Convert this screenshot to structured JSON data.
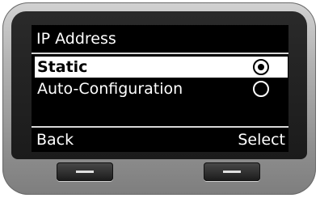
{
  "screen": {
    "title": "IP Address",
    "options": [
      {
        "label": "Static",
        "selected": true,
        "checked": true
      },
      {
        "label": "Auto-Configuration",
        "selected": false,
        "checked": false
      }
    ]
  },
  "softkeys": {
    "left_label": "Back",
    "right_label": "Select"
  },
  "colors": {
    "screen_bg": "#000000",
    "screen_text": "#ffffff",
    "highlight_bg": "#ffffff",
    "housing": "#a8a8a8"
  }
}
